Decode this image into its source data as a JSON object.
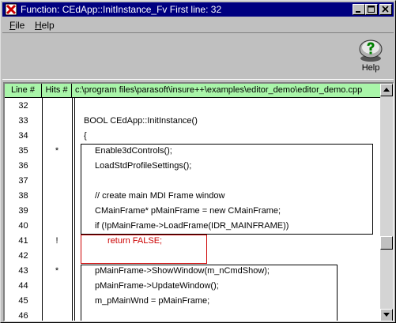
{
  "window": {
    "title": "Function: CEdApp::InitInstance_Fv    First line: 32"
  },
  "menu": {
    "file": {
      "underlined": "F",
      "rest": "ile"
    },
    "help": {
      "underlined": "H",
      "rest": "elp"
    }
  },
  "toolbar": {
    "help_label": "Help",
    "help_icon": "question-mark-icon"
  },
  "table": {
    "col_line": "Line #",
    "col_hits": "Hits #",
    "file_path": "c:\\program files\\parasoft\\insure++\\examples\\editor_demo\\editor_demo.cpp",
    "rows": [
      {
        "line": "32",
        "hits": "",
        "code": ""
      },
      {
        "line": "33",
        "hits": "",
        "code": "BOOL CEdApp::InitInstance()"
      },
      {
        "line": "34",
        "hits": "",
        "code": "{"
      },
      {
        "line": "35",
        "hits": "*",
        "code": "Enable3dControls();"
      },
      {
        "line": "36",
        "hits": "",
        "code": "LoadStdProfileSettings();"
      },
      {
        "line": "37",
        "hits": "",
        "code": ""
      },
      {
        "line": "38",
        "hits": "",
        "code": "// create main MDI Frame window"
      },
      {
        "line": "39",
        "hits": "",
        "code": "CMainFrame* pMainFrame = new CMainFrame;"
      },
      {
        "line": "40",
        "hits": "",
        "code": "if (!pMainFrame->LoadFrame(IDR_MAINFRAME))"
      },
      {
        "line": "41",
        "hits": "!",
        "code": "return FALSE;"
      },
      {
        "line": "42",
        "hits": "",
        "code": ""
      },
      {
        "line": "43",
        "hits": "*",
        "code": "pMainFrame->ShowWindow(m_nCmdShow);"
      },
      {
        "line": "44",
        "hits": "",
        "code": "pMainFrame->UpdateWindow();"
      },
      {
        "line": "45",
        "hits": "",
        "code": "m_pMainWnd = pMainFrame;"
      },
      {
        "line": "46",
        "hits": "",
        "code": ""
      }
    ]
  },
  "colors": {
    "title_bar": "#000080",
    "header_green": "#a9f5a9",
    "uncovered_red": "#cc0000"
  }
}
